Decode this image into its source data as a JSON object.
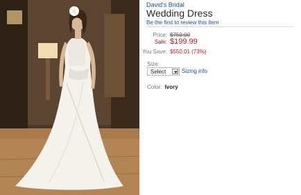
{
  "product": {
    "brand": "David's Bridal",
    "title": "Wedding Dress",
    "review_prompt": "Be the first to review this item",
    "image_alt": "Model wearing white halter wedding dress"
  },
  "pricing": {
    "price_label": "Price:",
    "price_value": "$750.00",
    "sale_label": "Sale:",
    "sale_value": "$199.99",
    "save_label": "You Save:",
    "save_value": "$550.01 (73%)"
  },
  "size": {
    "label": "Size:",
    "selected": "Select",
    "sizing_info": "Sizing info"
  },
  "color": {
    "label": "Color:",
    "value": "Ivory"
  },
  "colors": {
    "link": "#1a4d9e",
    "sale": "#c0161c",
    "divider": "#d6dbe3"
  }
}
